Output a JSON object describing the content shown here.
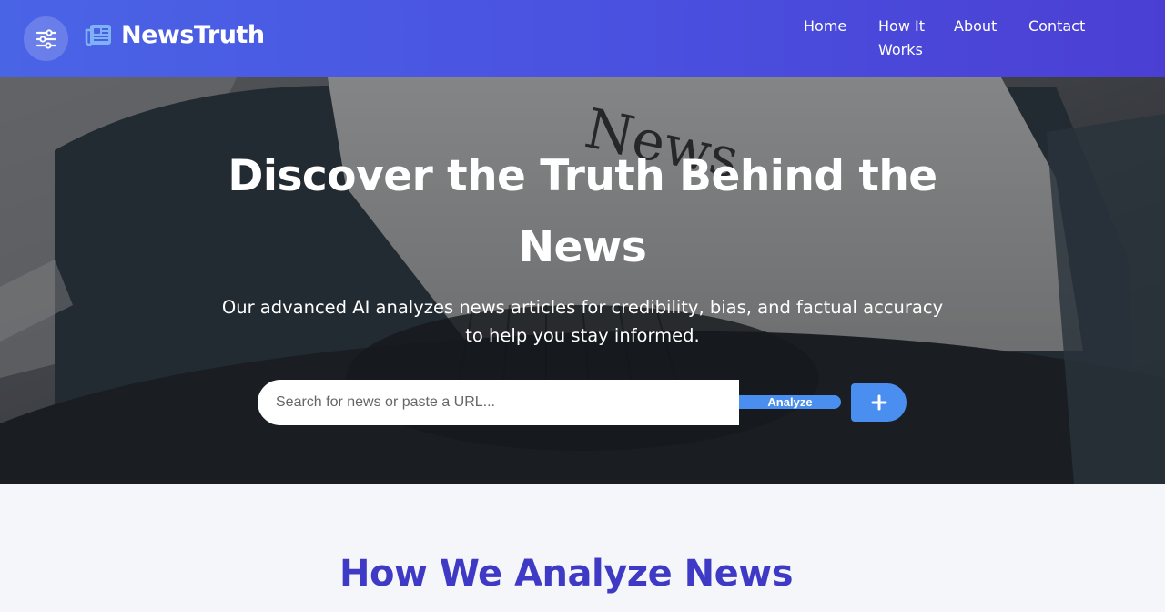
{
  "header": {
    "brand_name": "NewsTruth",
    "nav": {
      "home": "Home",
      "how_it_works": "How It Works",
      "about": "About",
      "contact": "Contact"
    }
  },
  "hero": {
    "title_line1": "Discover the Truth Behind the",
    "title_line2": "News",
    "subtitle_line1": "Our advanced AI analyzes news articles for credibility, bias, and factual accuracy",
    "subtitle_line2": "to help you stay informed.",
    "search_placeholder": "Search for news or paste a URL...",
    "analyze_label": "Analyze",
    "background_word": "News"
  },
  "section": {
    "title": "How We Analyze News"
  },
  "icons": {
    "menu": "sliders-icon",
    "brand": "newspaper-icon",
    "plus": "plus-icon"
  },
  "colors": {
    "header_start": "#4a64e6",
    "header_end": "#4b3fd3",
    "accent_blue": "#4a8ff0",
    "section_title": "#3f3ac5",
    "page_bg": "#f5f6fa"
  }
}
